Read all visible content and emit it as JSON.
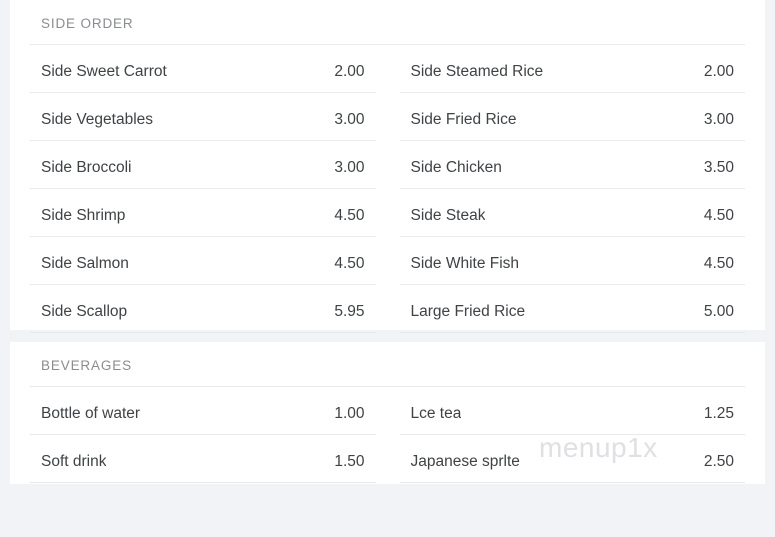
{
  "sections": [
    {
      "title": "SIDE ORDER",
      "items": [
        {
          "name": "Side Sweet Carrot",
          "price": "2.00"
        },
        {
          "name": "Side Steamed Rice",
          "price": "2.00"
        },
        {
          "name": "Side Vegetables",
          "price": "3.00"
        },
        {
          "name": "Side Fried Rice",
          "price": "3.00"
        },
        {
          "name": "Side Broccoli",
          "price": "3.00"
        },
        {
          "name": "Side Chicken",
          "price": "3.50"
        },
        {
          "name": "Side Shrimp",
          "price": "4.50"
        },
        {
          "name": "Side Steak",
          "price": "4.50"
        },
        {
          "name": "Side Salmon",
          "price": "4.50"
        },
        {
          "name": "Side White Fish",
          "price": "4.50"
        },
        {
          "name": "Side Scallop",
          "price": "5.95"
        },
        {
          "name": "Large Fried Rice",
          "price": "5.00"
        }
      ]
    },
    {
      "title": "BEVERAGES",
      "items": [
        {
          "name": "Bottle of water",
          "price": "1.00"
        },
        {
          "name": "Lce tea",
          "price": "1.25"
        },
        {
          "name": "Soft drink",
          "price": "1.50"
        },
        {
          "name": "Japanese sprlte",
          "price": "2.50"
        }
      ]
    }
  ],
  "watermark": {
    "text": "menup1x"
  }
}
